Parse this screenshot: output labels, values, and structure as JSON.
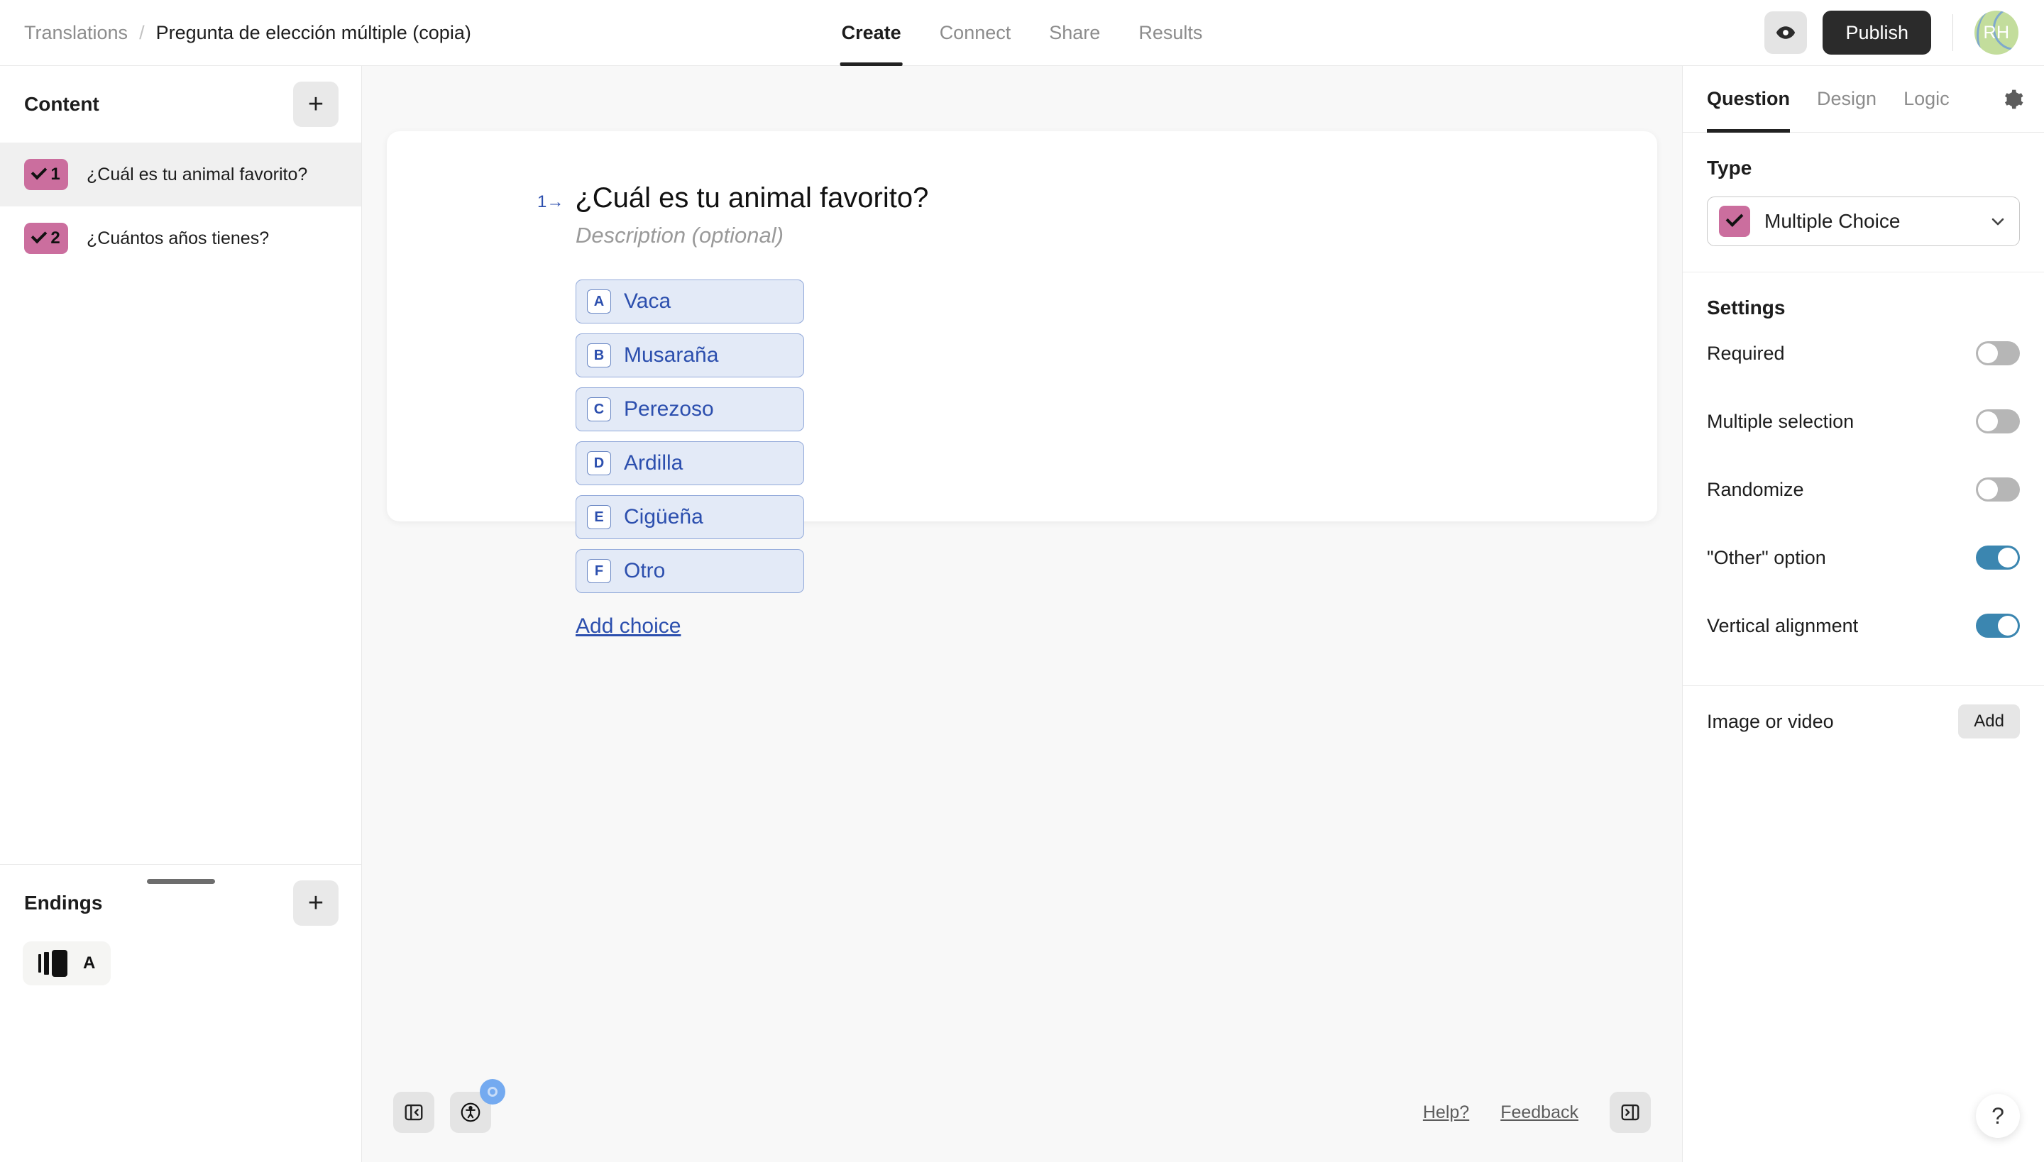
{
  "header": {
    "breadcrumb_parent": "Translations",
    "breadcrumb_separator": "/",
    "breadcrumb_title": "Pregunta de elección múltiple (copia)",
    "tabs": [
      {
        "label": "Create",
        "active": true
      },
      {
        "label": "Connect",
        "active": false
      },
      {
        "label": "Share",
        "active": false
      },
      {
        "label": "Results",
        "active": false
      }
    ],
    "preview_icon": "eye-icon",
    "publish_label": "Publish",
    "avatar_initials": "RH"
  },
  "sidebar": {
    "content_title": "Content",
    "add_content_label": "+",
    "questions": [
      {
        "number": "1",
        "label": "¿Cuál es tu animal favorito?",
        "selected": true
      },
      {
        "number": "2",
        "label": "¿Cuántos años tienes?",
        "selected": false
      }
    ],
    "endings_title": "Endings",
    "add_ending_label": "+",
    "endings": [
      {
        "letter": "A",
        "icon": "ending-card-icon"
      }
    ]
  },
  "canvas": {
    "question_index": "1",
    "question_arrow": "→",
    "question_title": "¿Cuál es tu animal favorito?",
    "description_placeholder": "Description (optional)",
    "choices": [
      {
        "key": "A",
        "label": "Vaca"
      },
      {
        "key": "B",
        "label": "Musaraña"
      },
      {
        "key": "C",
        "label": "Perezoso"
      },
      {
        "key": "D",
        "label": "Ardilla"
      },
      {
        "key": "E",
        "label": "Cigüeña"
      },
      {
        "key": "F",
        "label": "Otro"
      }
    ],
    "add_choice_label": "Add choice"
  },
  "footer": {
    "collapse_left_icon": "panel-collapse-left-icon",
    "accessibility_icon": "accessibility-icon",
    "help_label": "Help?",
    "feedback_label": "Feedback",
    "collapse_right_icon": "panel-collapse-right-icon",
    "help_fab_label": "?"
  },
  "right_panel": {
    "tabs": [
      {
        "label": "Question",
        "active": true
      },
      {
        "label": "Design",
        "active": false
      },
      {
        "label": "Logic",
        "active": false
      }
    ],
    "gear_icon": "gear-icon",
    "type_title": "Type",
    "type_value": "Multiple Choice",
    "type_chevron": "chevron-down-icon",
    "settings_title": "Settings",
    "settings": [
      {
        "label": "Required",
        "on": false
      },
      {
        "label": "Multiple selection",
        "on": false
      },
      {
        "label": "Randomize",
        "on": false
      },
      {
        "label": "\"Other\" option",
        "on": true
      },
      {
        "label": "Vertical alignment",
        "on": true
      }
    ],
    "media_label": "Image or video",
    "media_add_label": "Add"
  },
  "colors": {
    "accent_pink": "#cb6e9e",
    "choice_blue": "#2c4fae",
    "toggle_on": "#3b86b0",
    "publish_bg": "#2b2b2b",
    "canvas_bg": "#f8f8f8"
  }
}
